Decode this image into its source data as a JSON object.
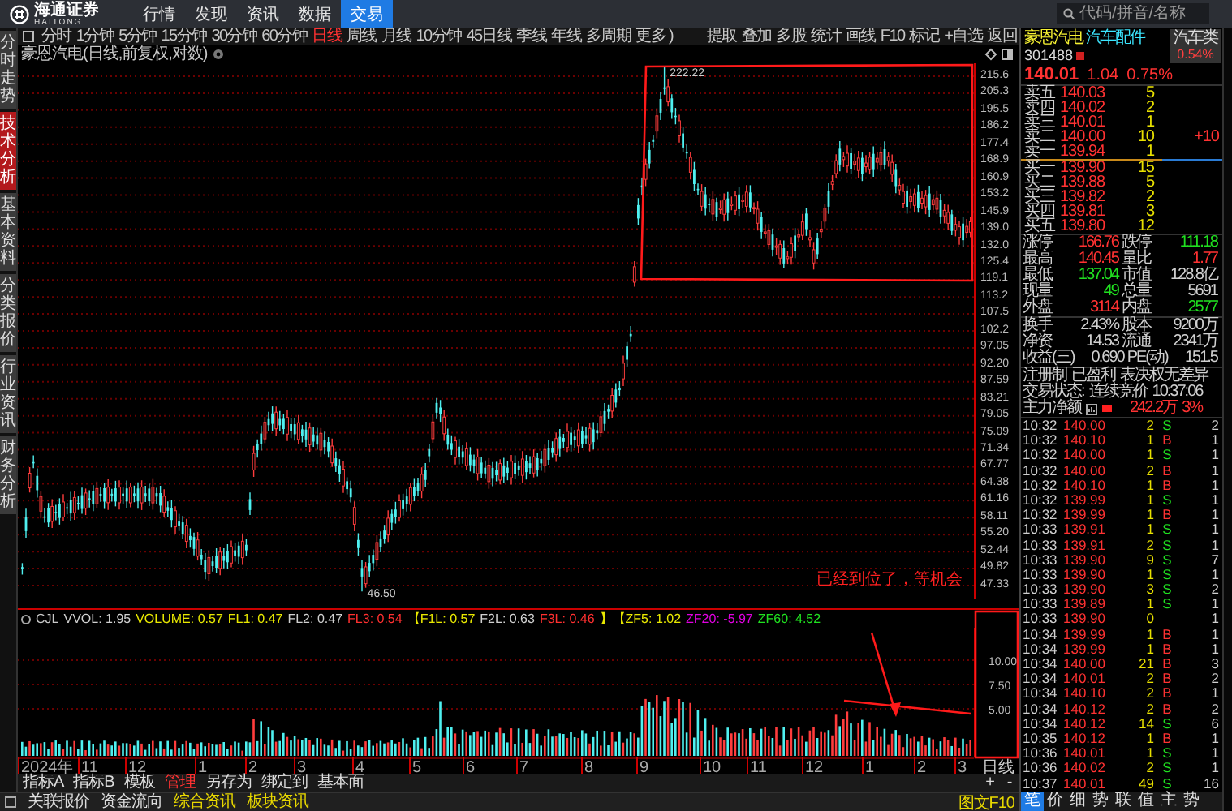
{
  "top_bar": {
    "logo": {
      "name": "海通证券",
      "subtitle": "HAITONG"
    },
    "nav": [
      {
        "label": "行情",
        "selected": false
      },
      {
        "label": "发现",
        "selected": false
      },
      {
        "label": "资讯",
        "selected": false
      },
      {
        "label": "数据",
        "selected": false
      },
      {
        "label": "交易",
        "selected": true
      }
    ],
    "search": {
      "placeholder": "代码/拼音/名称"
    }
  },
  "side_tabs": [
    {
      "label": "分时走势",
      "selected": false
    },
    {
      "label": "技术分析",
      "selected": true
    },
    {
      "label": "基本资料",
      "selected": false
    },
    {
      "label": "分类报价",
      "selected": false
    },
    {
      "label": "行业资讯",
      "selected": false
    },
    {
      "label": "财务分析",
      "selected": false
    }
  ],
  "period_bar": {
    "periods": [
      {
        "label": "分时",
        "selected": false
      },
      {
        "label": "1分钟",
        "selected": false
      },
      {
        "label": "5分钟",
        "selected": false
      },
      {
        "label": "15分钟",
        "selected": false
      },
      {
        "label": "30分钟",
        "selected": false
      },
      {
        "label": "60分钟",
        "selected": false
      },
      {
        "label": "日线",
        "selected": true
      },
      {
        "label": "周线",
        "selected": false
      },
      {
        "label": "月线",
        "selected": false
      },
      {
        "label": "10分钟",
        "selected": false
      },
      {
        "label": "45日线",
        "selected": false
      },
      {
        "label": "季线",
        "selected": false
      },
      {
        "label": "年线",
        "selected": false
      },
      {
        "label": "多周期",
        "selected": false
      },
      {
        "label": "更多 )",
        "selected": false
      }
    ],
    "tools": [
      "提取",
      "叠加",
      "多股",
      "统计",
      "画线",
      "F10",
      "标记",
      "+自选",
      "返回"
    ]
  },
  "chart": {
    "title": "豪恩汽电(日线,前复权,对数)",
    "price_axis": [
      "215.6",
      "205.3",
      "195.5",
      "186.2",
      "177.4",
      "168.9",
      "160.9",
      "153.2",
      "145.9",
      "139.0",
      "132.0",
      "125.4",
      "119.1",
      "113.2",
      "107.5",
      "102.2",
      "97.05",
      "92.20",
      "87.59",
      "83.21",
      "79.05",
      "75.09",
      "71.34",
      "67.77",
      "64.38",
      "61.16",
      "58.11",
      "55.20",
      "52.44",
      "49.82",
      "47.33"
    ],
    "high_label": "222.22",
    "low_label": "46.50"
  },
  "annotation": {
    "note": "已经到位了，等机会"
  },
  "indicator": {
    "name": "CJL",
    "values": [
      {
        "text": "VVOL: 1.95",
        "color": "#d0d0d0"
      },
      {
        "text": "VOLUME: 0.57",
        "color": "#e8e800"
      },
      {
        "text": "FL1: 0.47",
        "color": "#e8e800"
      },
      {
        "text": "FL2: 0.47",
        "color": "#d0d0d0"
      },
      {
        "text": "FL3: 0.54",
        "color": "#ff3030"
      },
      {
        "text": "【F1L: 0.57",
        "color": "#e8e800"
      },
      {
        "text": "F2L: 0.63",
        "color": "#d0d0d0"
      },
      {
        "text": "F3L: 0.46",
        "color": "#ff3030"
      },
      {
        "text": "】【ZF5: 1.02",
        "color": "#e8e800"
      },
      {
        "text": "ZF20: -5.97",
        "color": "#e000e0"
      },
      {
        "text": "ZF60: 4.52",
        "color": "#20e020"
      }
    ],
    "axis": [
      "10.00",
      "7.50",
      "5.00"
    ]
  },
  "date_axis": [
    "2024年",
    "11",
    "12",
    "1",
    "2",
    "3",
    "4",
    "5",
    "6",
    "7",
    "8",
    "9",
    "10",
    "11",
    "12",
    "1",
    "2",
    "3"
  ],
  "period_label": "日线",
  "zoom_buttons": [
    "+",
    "-"
  ],
  "bottom_tabs": [
    {
      "label": "指标A",
      "selected": false
    },
    {
      "label": "指标B",
      "selected": false
    },
    {
      "label": "模板",
      "selected": false
    },
    {
      "label": "管理",
      "selected": true
    },
    {
      "label": "另存为",
      "selected": false
    },
    {
      "label": "绑定到",
      "selected": false
    },
    {
      "label": "基本面",
      "selected": false
    }
  ],
  "status_bar": {
    "links": [
      {
        "label": "关联报价",
        "highlighted": false
      },
      {
        "label": "资金流向",
        "highlighted": false
      },
      {
        "label": "综合资讯",
        "highlighted": true
      },
      {
        "label": "板块资讯",
        "highlighted": true
      }
    ],
    "right_link": "图文F10"
  },
  "quote": {
    "header": {
      "name": "豪恩汽电",
      "industry": "汽车配件",
      "code": "301488",
      "sector": {
        "label": "汽车类",
        "change": "0.54%"
      }
    },
    "price": {
      "last": "140.01",
      "change": "1.04",
      "change_pct": "0.75%"
    },
    "asks": [
      {
        "label": "卖五",
        "price": "140.03",
        "volume": "5"
      },
      {
        "label": "卖四",
        "price": "140.02",
        "volume": "2"
      },
      {
        "label": "卖三",
        "price": "140.01",
        "volume": "1"
      },
      {
        "label": "卖二",
        "price": "140.00",
        "volume": "10",
        "change": "+10"
      },
      {
        "label": "卖一",
        "price": "139.94",
        "volume": "1"
      }
    ],
    "bids": [
      {
        "label": "买一",
        "price": "139.90",
        "volume": "15"
      },
      {
        "label": "买二",
        "price": "139.88",
        "volume": "5"
      },
      {
        "label": "买三",
        "price": "139.82",
        "volume": "2"
      },
      {
        "label": "买四",
        "price": "139.81",
        "volume": "3"
      },
      {
        "label": "买五",
        "price": "139.80",
        "volume": "12"
      }
    ],
    "price_stats": [
      [
        {
          "label": "涨停",
          "value": "166.76",
          "color": "#ff3232"
        },
        {
          "label": "跌停",
          "value": "111.18",
          "color": "#20e020"
        }
      ],
      [
        {
          "label": "最高",
          "value": "140.45",
          "color": "#ff3232"
        },
        {
          "label": "量比",
          "value": "1.77",
          "color": "#ff3232"
        }
      ],
      [
        {
          "label": "最低",
          "value": "137.04",
          "color": "#20e020"
        },
        {
          "label": "市值",
          "value": "128.8亿",
          "color": "#d0d0d0"
        }
      ],
      [
        {
          "label": "现量",
          "value": "49",
          "color": "#20e020"
        },
        {
          "label": "总量",
          "value": "5691",
          "color": "#d0d0d0"
        }
      ],
      [
        {
          "label": "外盘",
          "value": "3114",
          "color": "#ff3232"
        },
        {
          "label": "内盘",
          "value": "2577",
          "color": "#20e020"
        }
      ]
    ],
    "fundamentals": [
      [
        {
          "label": "换手",
          "value": "2.43%",
          "color": "#d0d0d0"
        },
        {
          "label": "股本",
          "value": "9200万",
          "color": "#d0d0d0"
        }
      ],
      [
        {
          "label": "净资",
          "value": "14.53",
          "color": "#d0d0d0"
        },
        {
          "label": "流通",
          "value": "2341万",
          "color": "#d0d0d0"
        }
      ],
      [
        {
          "label": "收益(三)",
          "value": "0.690",
          "color": "#d0d0d0"
        },
        {
          "label": "PE(动)",
          "value": "151.5",
          "color": "#d0d0d0"
        }
      ]
    ],
    "tags": [
      "注册制",
      "已盈利",
      "表决权无差异"
    ],
    "trade_status": {
      "label": "交易状态:",
      "state": "连续竞价",
      "time": "10:37:06"
    },
    "main_net": {
      "label": "主力净额",
      "value": "242.2万",
      "percent": "3%",
      "level": 0.4
    },
    "trades": [
      {
        "time": "10:32",
        "price": "140.00",
        "volume": "2",
        "flag": "S",
        "color": "#20e020",
        "column_5": "2"
      },
      {
        "time": "10:32",
        "price": "140.10",
        "volume": "1",
        "flag": "B",
        "color": "#ff3232",
        "column_5": "1"
      },
      {
        "time": "10:32",
        "price": "140.00",
        "volume": "1",
        "flag": "S",
        "color": "#20e020",
        "column_5": "1"
      },
      {
        "time": "10:32",
        "price": "140.00",
        "volume": "2",
        "flag": "B",
        "color": "#ff3232",
        "column_5": "1"
      },
      {
        "time": "10:32",
        "price": "140.10",
        "volume": "1",
        "flag": "B",
        "color": "#ff3232",
        "column_5": "1"
      },
      {
        "time": "10:32",
        "price": "139.99",
        "volume": "1",
        "flag": "S",
        "color": "#20e020",
        "column_5": "1"
      },
      {
        "time": "10:32",
        "price": "139.99",
        "volume": "1",
        "flag": "B",
        "color": "#ff3232",
        "column_5": "1"
      },
      {
        "time": "10:33",
        "price": "139.91",
        "volume": "1",
        "flag": "S",
        "color": "#20e020",
        "column_5": "1"
      },
      {
        "time": "10:33",
        "price": "139.91",
        "volume": "2",
        "flag": "S",
        "color": "#20e020",
        "column_5": "1"
      },
      {
        "time": "10:33",
        "price": "139.90",
        "volume": "9",
        "flag": "S",
        "color": "#20e020",
        "column_5": "7"
      },
      {
        "time": "10:33",
        "price": "139.90",
        "volume": "1",
        "flag": "S",
        "color": "#20e020",
        "column_5": "1"
      },
      {
        "time": "10:33",
        "price": "139.90",
        "volume": "3",
        "flag": "S",
        "color": "#20e020",
        "column_5": "2"
      },
      {
        "time": "10:33",
        "price": "139.89",
        "volume": "1",
        "flag": "S",
        "color": "#20e020",
        "column_5": "1"
      },
      {
        "time": "10:33",
        "price": "139.90",
        "volume": "0",
        "column_5": "1"
      },
      {
        "time": "10:34",
        "price": "139.99",
        "volume": "1",
        "flag": "B",
        "color": "#ff3232",
        "column_5": "1"
      },
      {
        "time": "10:34",
        "price": "139.99",
        "volume": "1",
        "flag": "B",
        "color": "#ff3232",
        "column_5": "1"
      },
      {
        "time": "10:34",
        "price": "140.00",
        "volume": "21",
        "flag": "B",
        "color": "#ff3232",
        "column_5": "3"
      },
      {
        "time": "10:34",
        "price": "140.01",
        "volume": "2",
        "flag": "B",
        "color": "#ff3232",
        "column_5": "2"
      },
      {
        "time": "10:34",
        "price": "140.10",
        "volume": "2",
        "flag": "B",
        "color": "#ff3232",
        "column_5": "1"
      },
      {
        "time": "10:34",
        "price": "140.12",
        "volume": "2",
        "flag": "B",
        "color": "#ff3232",
        "column_5": "2"
      },
      {
        "time": "10:34",
        "price": "140.12",
        "volume": "14",
        "flag": "S",
        "color": "#20e020",
        "column_5": "6"
      },
      {
        "time": "10:35",
        "price": "140.12",
        "volume": "1",
        "flag": "B",
        "color": "#ff3232",
        "column_5": "1"
      },
      {
        "time": "10:36",
        "price": "140.01",
        "volume": "1",
        "flag": "S",
        "color": "#20e020",
        "column_5": "1"
      },
      {
        "time": "10:36",
        "price": "140.02",
        "volume": "2",
        "flag": "S",
        "color": "#20e020",
        "column_5": "1"
      },
      {
        "time": "10:37",
        "price": "140.01",
        "volume": "49",
        "flag": "S",
        "color": "#20e020",
        "column_5": "16"
      }
    ],
    "trade_tabs": [
      {
        "label": "笔",
        "selected": true
      },
      {
        "label": "价",
        "selected": false
      },
      {
        "label": "细",
        "selected": false
      },
      {
        "label": "势",
        "selected": false
      },
      {
        "label": "联",
        "selected": false
      },
      {
        "label": "值",
        "selected": false
      },
      {
        "label": "主",
        "selected": false
      },
      {
        "label": "势",
        "selected": false
      }
    ]
  }
}
